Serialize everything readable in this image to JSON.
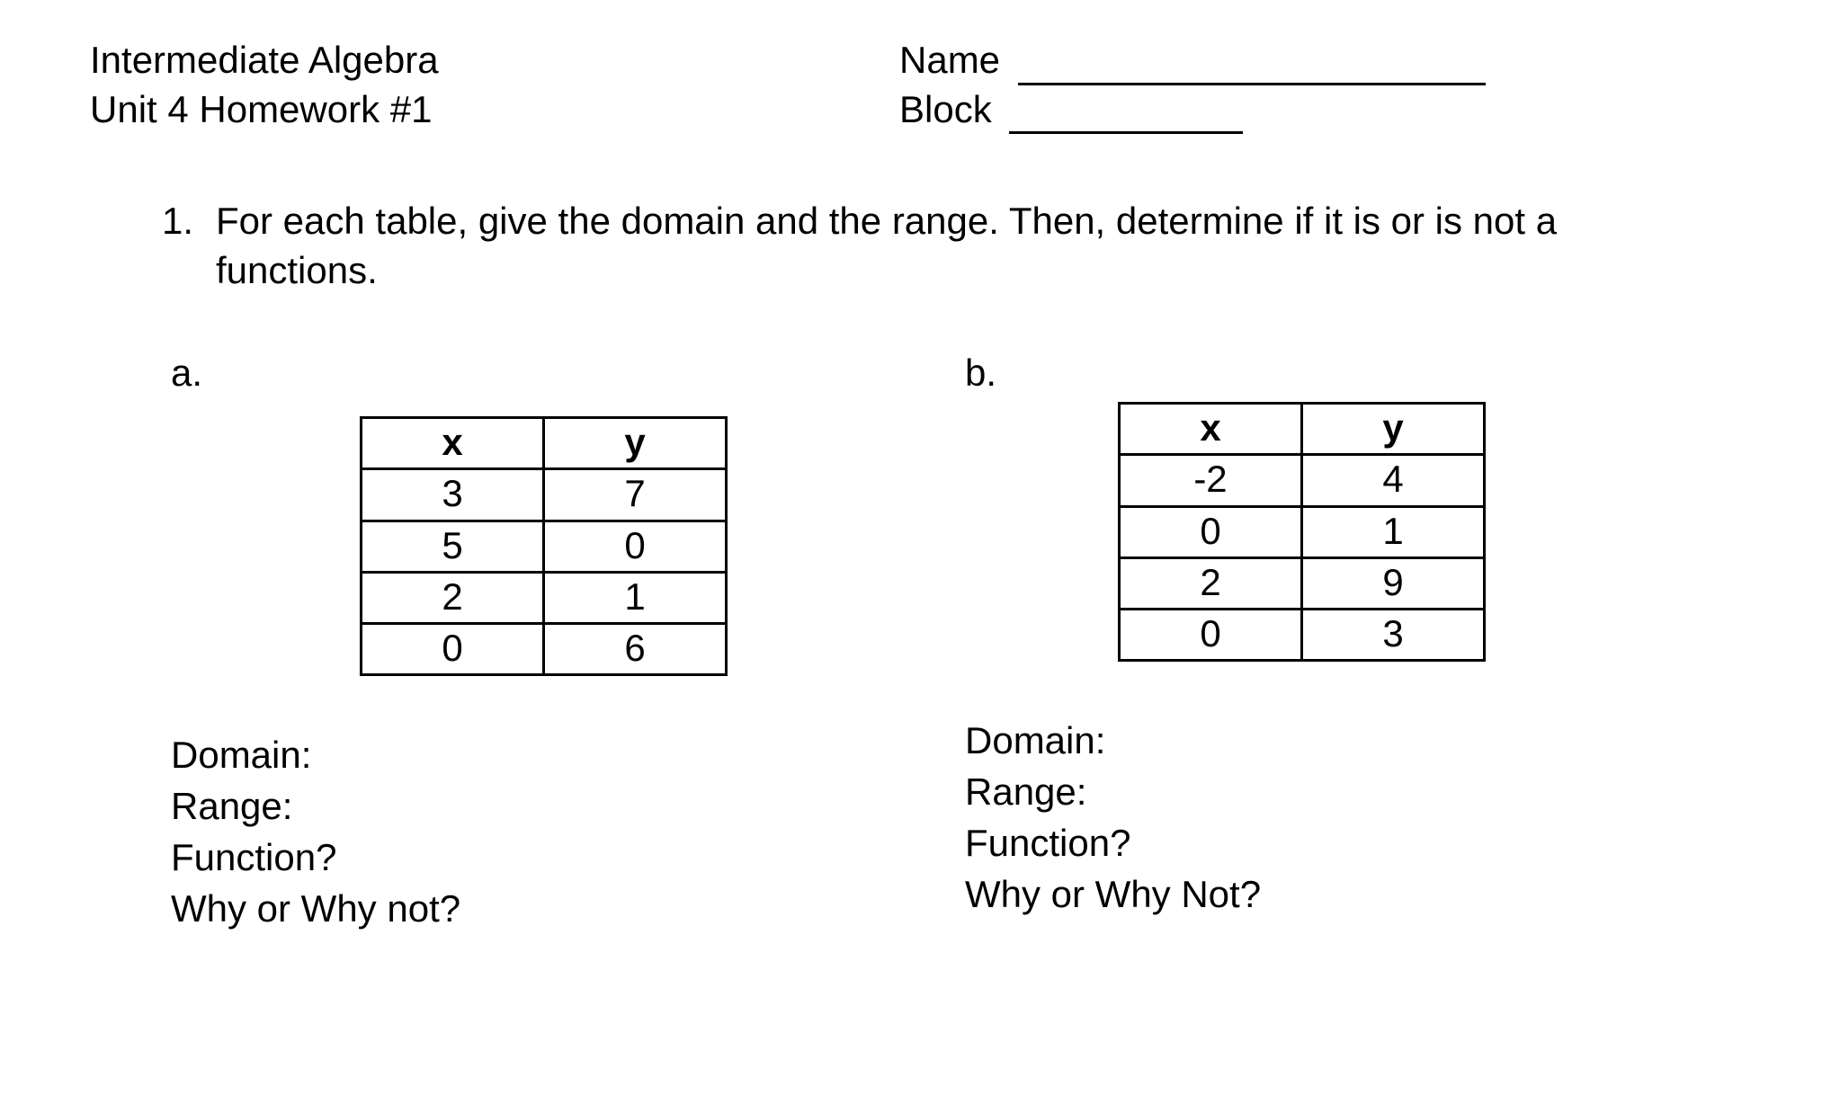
{
  "header": {
    "course": "Intermediate Algebra",
    "assignment": "Unit 4 Homework #1",
    "name_label": "Name",
    "block_label": "Block"
  },
  "question": {
    "number": "1.",
    "prompt": "For each table, give the domain and the range.  Then, determine if it is or is not a functions."
  },
  "parts": {
    "a": {
      "label": "a.",
      "headers": {
        "x": "x",
        "y": "y"
      },
      "rows": [
        {
          "x": "3",
          "y": "7"
        },
        {
          "x": "5",
          "y": "0"
        },
        {
          "x": "2",
          "y": "1"
        },
        {
          "x": "0",
          "y": "6"
        }
      ],
      "answers": {
        "domain": "Domain:",
        "range": "Range:",
        "function": "Function?",
        "why": "Why or Why not?"
      }
    },
    "b": {
      "label": "b.",
      "headers": {
        "x": "x",
        "y": "y"
      },
      "rows": [
        {
          "x": "-2",
          "y": "4"
        },
        {
          "x": "0",
          "y": "1"
        },
        {
          "x": "2",
          "y": "9"
        },
        {
          "x": "0",
          "y": "3"
        }
      ],
      "answers": {
        "domain": "Domain:",
        "range": "Range:",
        "function": "Function?",
        "why": "Why or Why Not?"
      }
    }
  },
  "chart_data": [
    {
      "type": "table",
      "title": "a",
      "columns": [
        "x",
        "y"
      ],
      "rows": [
        [
          3,
          7
        ],
        [
          5,
          0
        ],
        [
          2,
          1
        ],
        [
          0,
          6
        ]
      ]
    },
    {
      "type": "table",
      "title": "b",
      "columns": [
        "x",
        "y"
      ],
      "rows": [
        [
          -2,
          4
        ],
        [
          0,
          1
        ],
        [
          2,
          9
        ],
        [
          0,
          3
        ]
      ]
    }
  ]
}
